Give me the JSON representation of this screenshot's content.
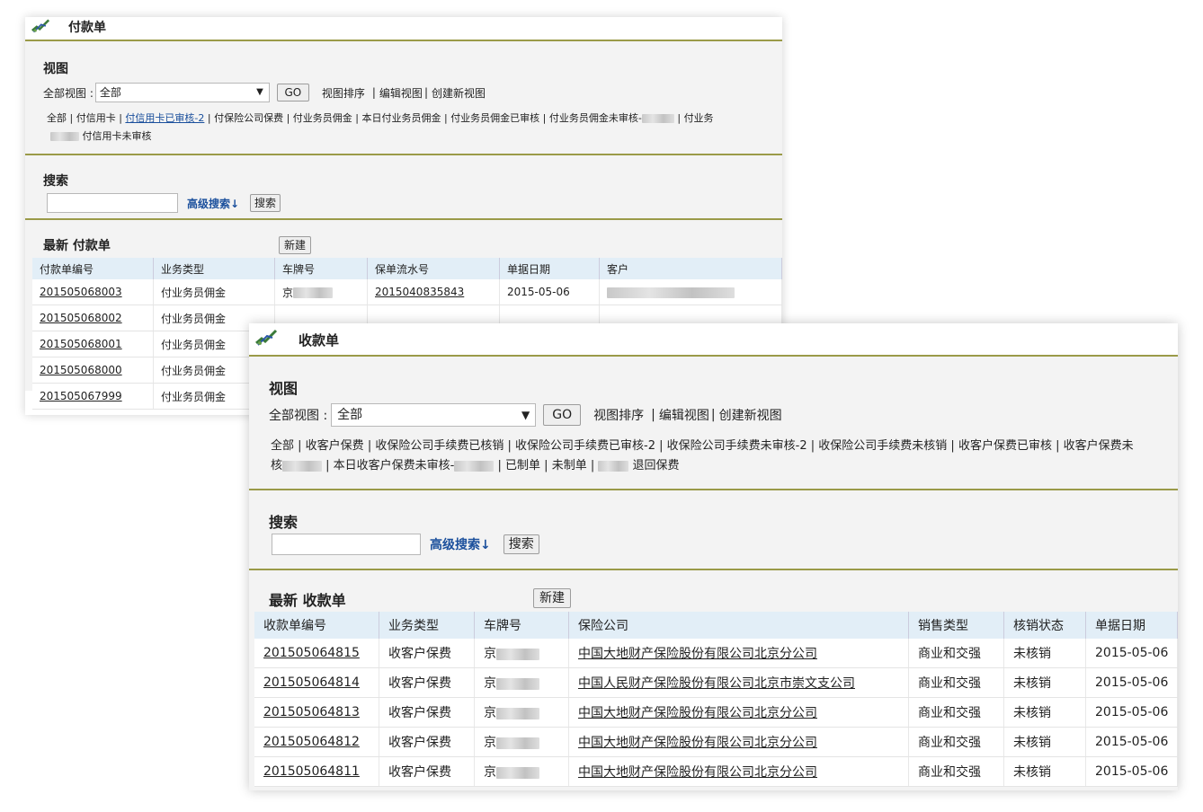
{
  "payment_window": {
    "title": "付款单",
    "view": {
      "heading": "视图",
      "all_views_label": "全部视图 :",
      "selected_view": "全部",
      "go_label": "GO",
      "sort_link": "视图排序",
      "edit_link": "编辑视图",
      "create_link": "创建新视图",
      "filters_line1": [
        "全部",
        "付信用卡",
        "付信用卡已审核-2",
        "付保险公司保费",
        "付业务员佣金",
        "本日付业务员佣金",
        "付业务员佣金已审核",
        "付业务员佣金未审核-",
        "付业务"
      ],
      "filters_line2": [
        "付信用卡未审核"
      ]
    },
    "search": {
      "heading": "搜索",
      "input_value": "",
      "advanced_label": "高级搜索↓",
      "search_button": "搜索"
    },
    "list": {
      "heading": "最新 付款单",
      "new_button": "新建",
      "columns": [
        "付款单编号",
        "业务类型",
        "车牌号",
        "保单流水号",
        "单据日期",
        "客户"
      ],
      "rows": [
        {
          "id": "201505068003",
          "type": "付业务员佣金",
          "plate": "京",
          "policy": "2015040835843",
          "date": "2015-05-06"
        },
        {
          "id": "201505068002",
          "type": "付业务员佣金"
        },
        {
          "id": "201505068001",
          "type": "付业务员佣金"
        },
        {
          "id": "201505068000",
          "type": "付业务员佣金"
        },
        {
          "id": "201505067999",
          "type": "付业务员佣金"
        }
      ]
    }
  },
  "receipt_window": {
    "title": "收款单",
    "view": {
      "heading": "视图",
      "all_views_label": "全部视图 :",
      "selected_view": "全部",
      "go_label": "GO",
      "sort_link": "视图排序",
      "edit_link": "编辑视图",
      "create_link": "创建新视图",
      "filters_line1": [
        "全部",
        "收客户保费",
        "收保险公司手续费已核销",
        "收保险公司手续费已审核-2",
        "收保险公司手续费未审核-2",
        "收保险公司手续费未核销",
        "收客户保费已审核",
        "收客户保费未"
      ],
      "filters_line2_start": "核",
      "filters_line2": [
        "本日收客户保费未审核-",
        "已制单",
        "未制单",
        "退回保费"
      ]
    },
    "search": {
      "heading": "搜索",
      "input_value": "",
      "advanced_label": "高级搜索↓",
      "search_button": "搜索"
    },
    "list": {
      "heading": "最新 收款单",
      "new_button": "新建",
      "columns": [
        "收款单编号",
        "业务类型",
        "车牌号",
        "保险公司",
        "销售类型",
        "核销状态",
        "单据日期"
      ],
      "rows": [
        {
          "id": "201505064815",
          "type": "收客户保费",
          "plate": "京",
          "company": "中国大地财产保险股份有限公司北京分公司",
          "sales": "商业和交强",
          "status": "未核销",
          "date": "2015-05-06"
        },
        {
          "id": "201505064814",
          "type": "收客户保费",
          "plate": "京",
          "company": "中国人民财产保险股份有限公司北京市崇文支公司",
          "sales": "商业和交强",
          "status": "未核销",
          "date": "2015-05-06"
        },
        {
          "id": "201505064813",
          "type": "收客户保费",
          "plate": "京",
          "company": "中国大地财产保险股份有限公司北京分公司",
          "sales": "商业和交强",
          "status": "未核销",
          "date": "2015-05-06"
        },
        {
          "id": "201505064812",
          "type": "收客户保费",
          "plate": "京",
          "company": "中国大地财产保险股份有限公司北京分公司",
          "sales": "商业和交强",
          "status": "未核销",
          "date": "2015-05-06"
        },
        {
          "id": "201505064811",
          "type": "收客户保费",
          "plate": "京",
          "company": "中国大地财产保险股份有限公司北京分公司",
          "sales": "商业和交强",
          "status": "未核销",
          "date": "2015-05-06"
        }
      ]
    }
  }
}
